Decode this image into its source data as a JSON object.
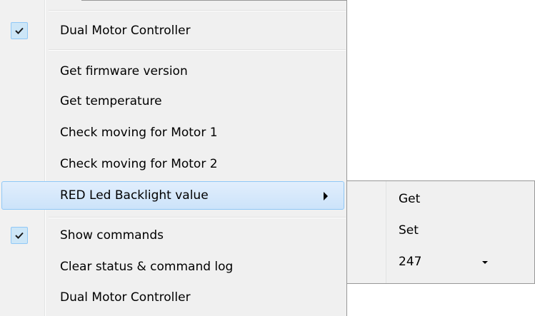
{
  "menu": {
    "items": [
      {
        "label": "Dual Motor Controller",
        "checked": true
      },
      {
        "label": "Get firmware version"
      },
      {
        "label": "Get temperature"
      },
      {
        "label": "Check moving for Motor 1"
      },
      {
        "label": "Check moving for Motor 2"
      },
      {
        "label": "RED Led Backlight value",
        "has_submenu": true,
        "highlighted": true
      },
      {
        "label": "Show commands",
        "checked": true
      },
      {
        "label": "Clear status & command log"
      },
      {
        "label": "Dual Motor Controller"
      }
    ]
  },
  "submenu": {
    "get_label": "Get",
    "set_label": "Set",
    "value": "247"
  },
  "colors": {
    "highlight_border": "#90c8f6",
    "highlight_fill": "#cce3fa",
    "menu_bg": "#f0f0f0"
  }
}
